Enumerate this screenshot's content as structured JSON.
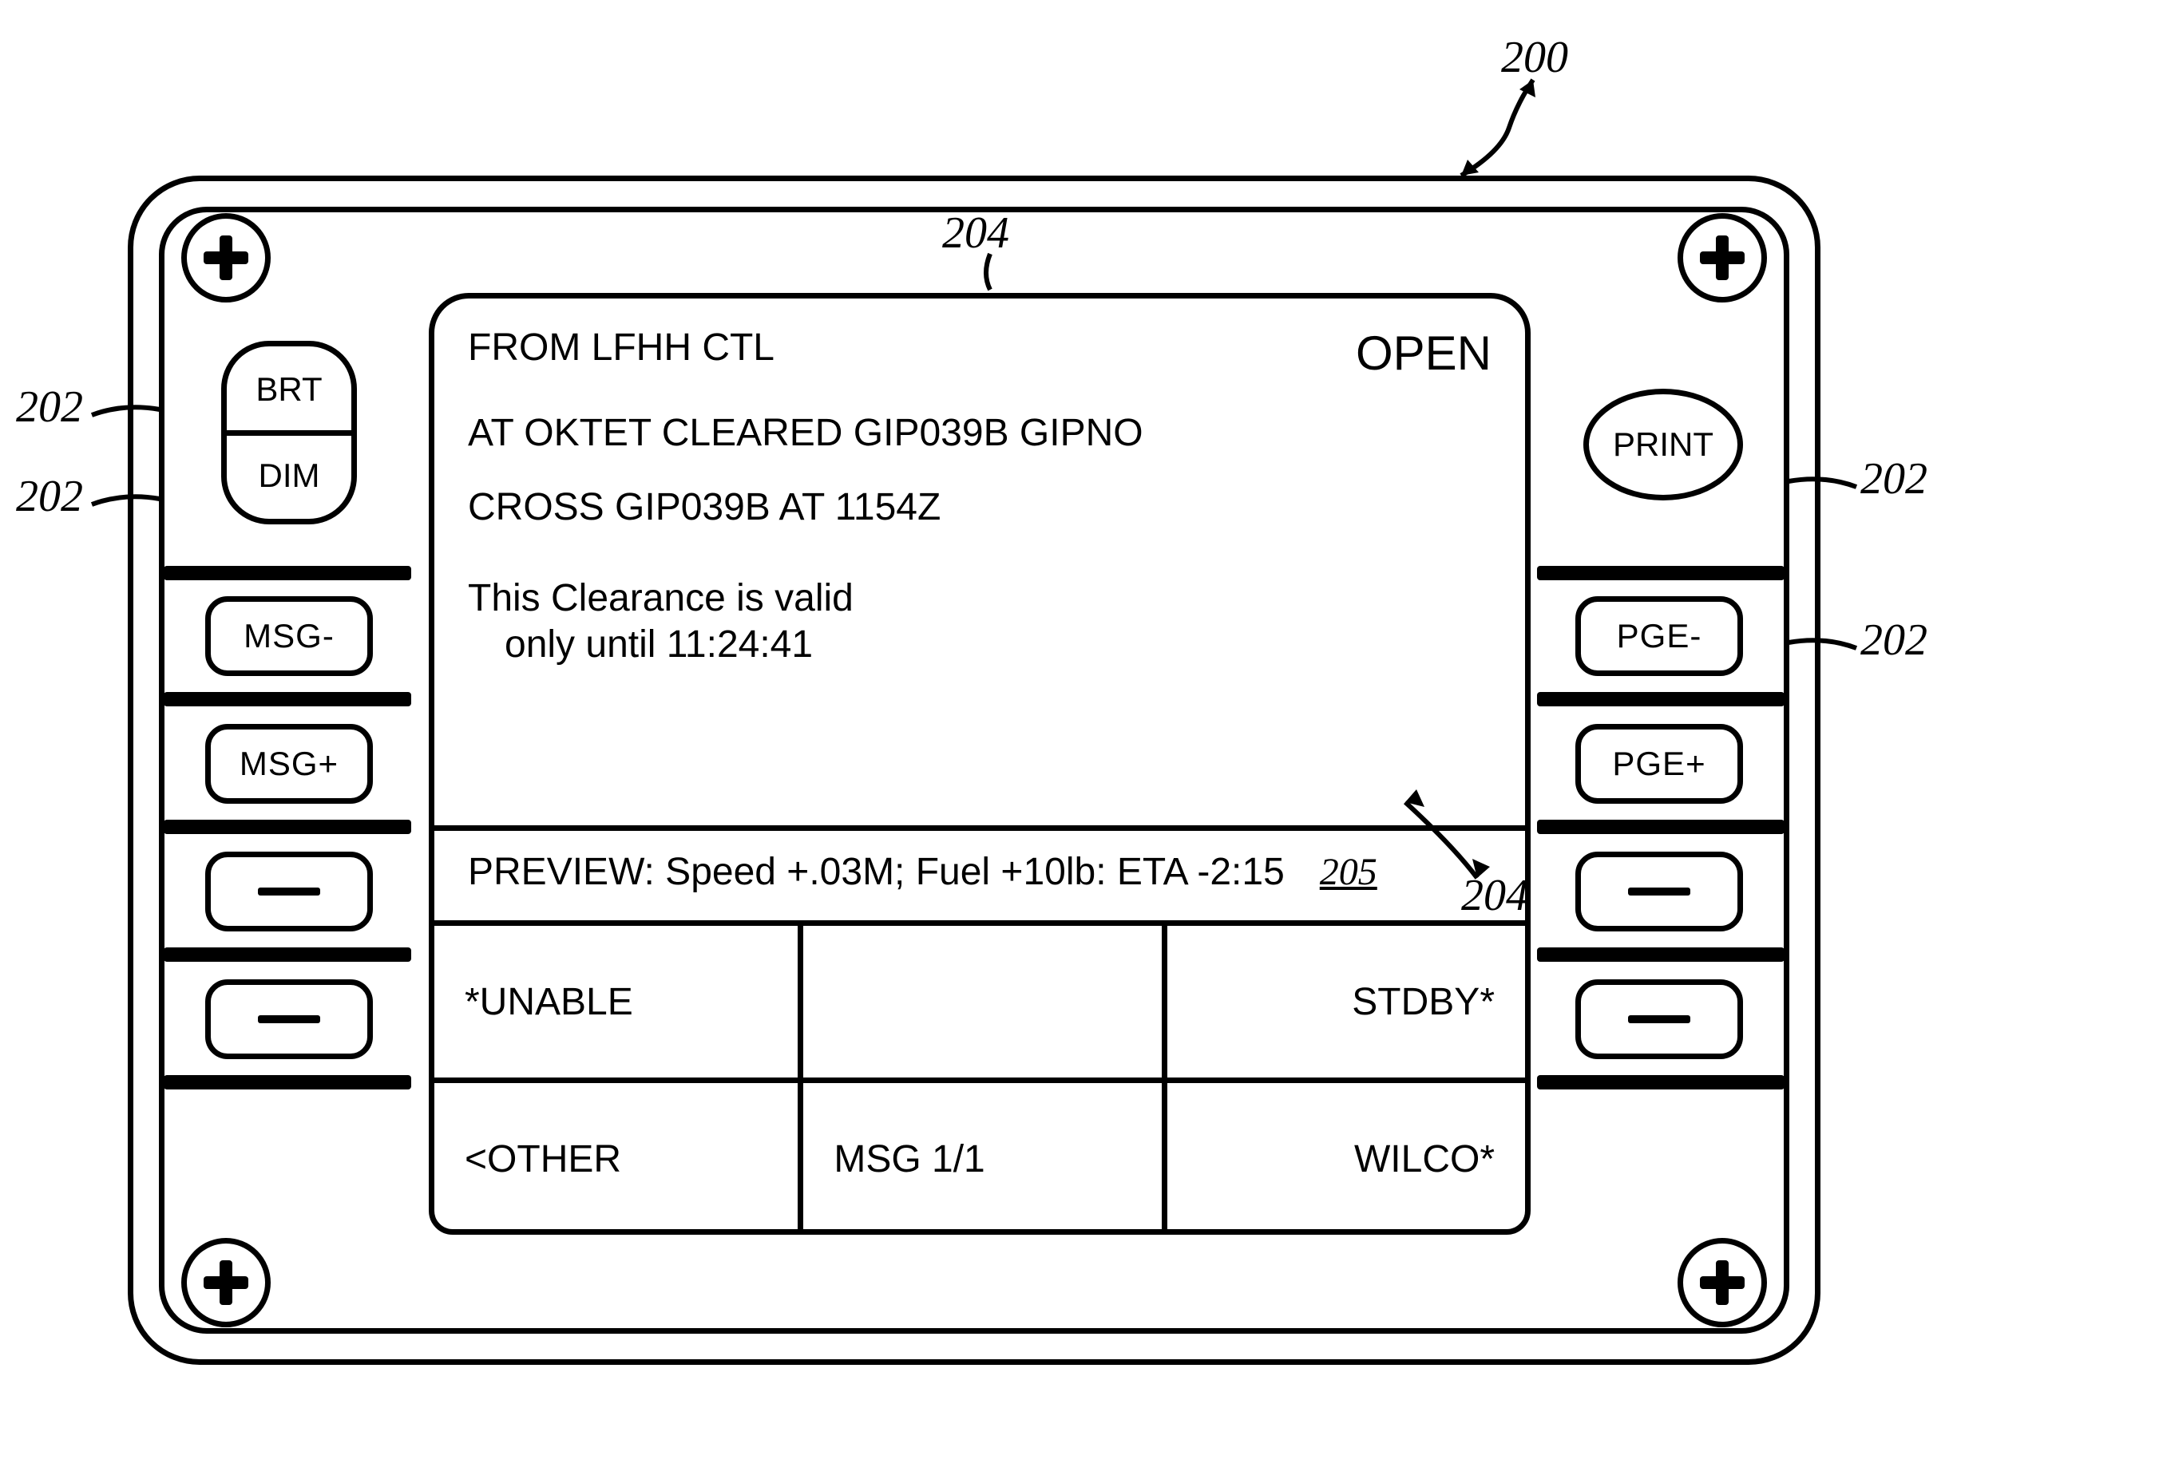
{
  "refs": {
    "fig": "200",
    "btn_top_left": "202",
    "btn_mid_left": "202",
    "print": "202",
    "pge_minus": "202",
    "screen_top": "204",
    "preview_arrow": "204",
    "preview_tag": "205"
  },
  "buttons": {
    "brt": "BRT",
    "dim": "DIM",
    "msg_minus": "MSG-",
    "msg_plus": "MSG+",
    "print": "PRINT",
    "pge_minus": "PGE-",
    "pge_plus": "PGE+"
  },
  "screen": {
    "from": "FROM LFHH CTL",
    "status": "OPEN",
    "line1": "AT OKTET CLEARED GIP039B GIPNO",
    "line2": "CROSS GIP039B AT 1154Z",
    "validity_l1": "This Clearance is valid",
    "validity_l2": "only until 11:24:41",
    "preview": "PREVIEW: Speed +.03M; Fuel +10lb: ETA -2:15",
    "soft": {
      "unable": "*UNABLE",
      "stdby": "STDBY*",
      "other": "<OTHER",
      "msg_page": "MSG 1/1",
      "wilco": "WILCO*"
    }
  }
}
